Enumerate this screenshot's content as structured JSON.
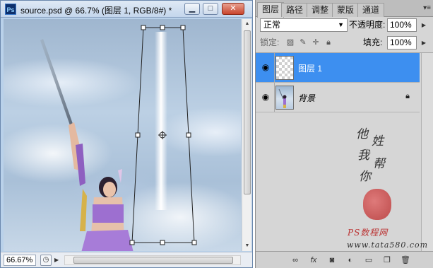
{
  "document": {
    "title": "source.psd @ 66.7% (图层 1, RGB/8#) *",
    "app_icon": "Ps",
    "zoom": "66.67%",
    "window_buttons": {
      "minimize": "▁",
      "maximize": "□",
      "close": "✕"
    }
  },
  "panel": {
    "tabs": [
      "图层",
      "路径",
      "调整",
      "蒙版",
      "通道"
    ],
    "active_tab": "图层",
    "blend_mode": "正常",
    "opacity_label": "不透明度:",
    "opacity_value": "100%",
    "lock_label": "锁定:",
    "fill_label": "填充:",
    "fill_value": "100%",
    "layers": [
      {
        "name": "图层 1",
        "selected": true,
        "visible": true,
        "locked": false
      },
      {
        "name": "背景",
        "selected": false,
        "visible": true,
        "locked": true
      }
    ],
    "signature_lines": [
      "他",
      "姓",
      "我",
      "帮",
      "你"
    ],
    "credit": "PS数程网",
    "site_url": "www.tata580.com"
  },
  "icons": {
    "eye": "eye-icon",
    "lock": "lock-icon",
    "link": "link-layers-icon",
    "fx": "fx-icon",
    "mask": "add-mask-icon",
    "adjustment": "adjustment-layer-icon",
    "group": "new-group-icon",
    "new_layer": "new-layer-icon",
    "trash": "delete-layer-icon"
  },
  "colors": {
    "selection": "#3d8ff0",
    "panel_bg": "#d6d6d6",
    "title_bg": "#c4d6ec"
  }
}
